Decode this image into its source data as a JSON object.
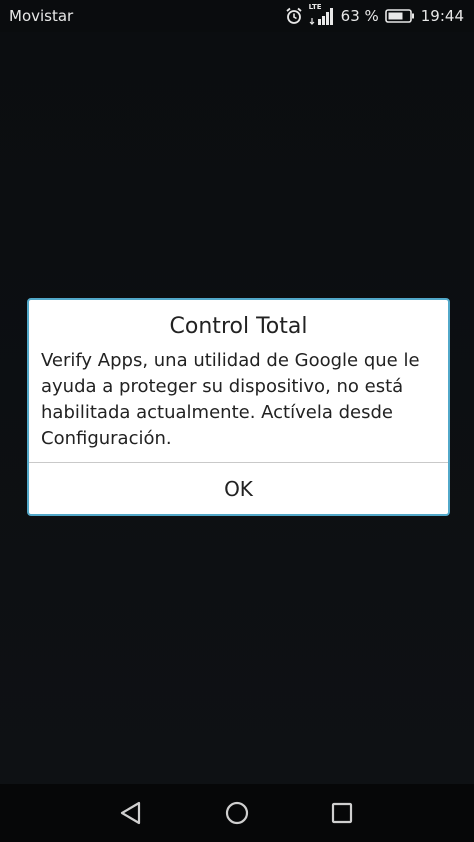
{
  "status_bar": {
    "carrier": "Movistar",
    "network_type": "LTE",
    "battery_percent": "63 %",
    "time": "19:44",
    "icons": [
      "alarm-icon",
      "signal-icon",
      "battery-icon"
    ]
  },
  "dialog": {
    "title": "Control Total",
    "message": "Verify Apps, una utilidad de Google que le ayuda a proteger su dispositivo, no está habilitada actualmente. Actívela desde Configuración.",
    "ok_label": "OK",
    "border_color": "#52a8c9"
  },
  "nav_bar": {
    "icons": [
      "back-icon",
      "home-icon",
      "recents-icon"
    ]
  }
}
